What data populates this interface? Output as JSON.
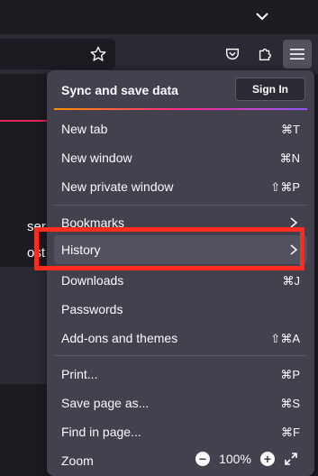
{
  "menu": {
    "header": {
      "title": "Sync and save data",
      "signin_label": "Sign In"
    },
    "items": [
      {
        "label": "New tab",
        "shortcut": "⌘T"
      },
      {
        "label": "New window",
        "shortcut": "⌘N"
      },
      {
        "label": "New private window",
        "shortcut": "⇧⌘P"
      },
      {
        "label": "Bookmarks",
        "shortcut": ""
      },
      {
        "label": "History",
        "shortcut": ""
      },
      {
        "label": "Downloads",
        "shortcut": "⌘J"
      },
      {
        "label": "Passwords",
        "shortcut": ""
      },
      {
        "label": "Add-ons and themes",
        "shortcut": "⇧⌘A"
      },
      {
        "label": "Print...",
        "shortcut": "⌘P"
      },
      {
        "label": "Save page as...",
        "shortcut": "⌘S"
      },
      {
        "label": "Find in page...",
        "shortcut": "⌘F"
      },
      {
        "label": "Zoom",
        "shortcut": ""
      }
    ],
    "zoom": {
      "value": "100%",
      "minus": "−",
      "plus": "+"
    }
  },
  "background": {
    "line1": "ser on",
    "line2": "ost con"
  },
  "icons": {
    "tabs": "chevron-down-icon",
    "star": "star-icon",
    "pocket": "pocket-icon",
    "extensions": "puzzle-icon",
    "menu": "hamburger-icon",
    "fullscreen": "fullscreen-icon"
  },
  "colors": {
    "highlight": "#ff2d1d",
    "menu_bg": "#42414d",
    "hover_bg": "#52525e"
  }
}
